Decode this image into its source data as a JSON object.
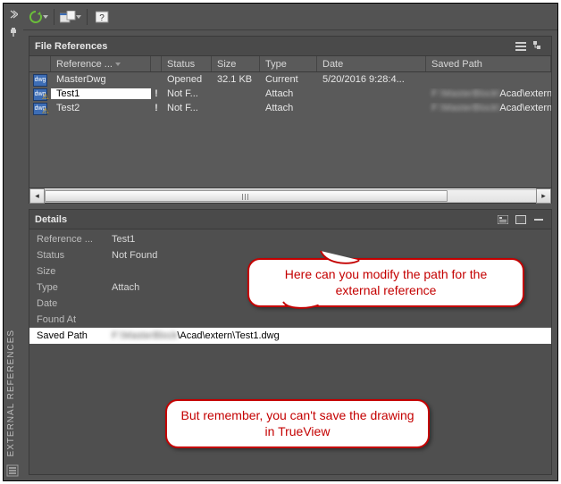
{
  "side": {
    "title": "EXTERNAL REFERENCES"
  },
  "panels": {
    "files": {
      "title": "File References",
      "columns": {
        "name": "Reference ...",
        "status": "Status",
        "size": "Size",
        "type": "Type",
        "date": "Date",
        "path": "Saved Path"
      },
      "rows": [
        {
          "name": "MasterDwg",
          "status": "Opened",
          "size": "32.1 KB",
          "type": "Current",
          "date": "5/20/2016 9:28:4...",
          "path": "",
          "warn": false,
          "selected": false
        },
        {
          "name": "Test1",
          "status": "Not F...",
          "size": "",
          "type": "Attach",
          "date": "",
          "path": "Acad\\extern",
          "warn": true,
          "selected": true
        },
        {
          "name": "Test2",
          "status": "Not F...",
          "size": "",
          "type": "Attach",
          "date": "",
          "path": "Acad\\extern",
          "warn": true,
          "selected": false
        }
      ]
    },
    "details": {
      "title": "Details",
      "rows": {
        "ref_label": "Reference ...",
        "ref_value": "Test1",
        "status_label": "Status",
        "status_value": "Not Found",
        "size_label": "Size",
        "size_value": "",
        "type_label": "Type",
        "type_value": "Attach",
        "date_label": "Date",
        "date_value": "",
        "found_label": "Found At",
        "found_value": "",
        "path_label": "Saved Path",
        "path_value": "\\Acad\\extern\\Test1.dwg"
      }
    }
  },
  "callouts": {
    "c1": "Here can you modify the path for the external reference",
    "c2": "But remember, you can't save the drawing in TrueView"
  }
}
